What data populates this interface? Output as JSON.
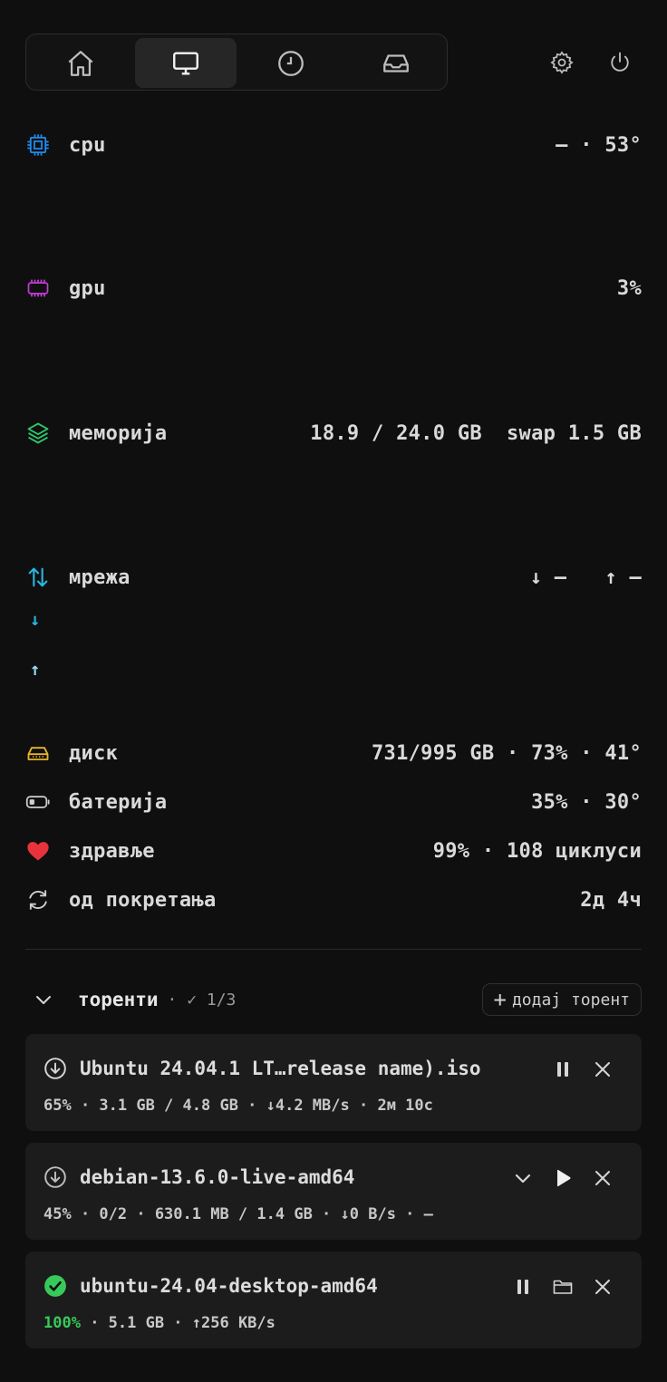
{
  "nav": {
    "tabs": [
      {
        "icon": "home-icon"
      },
      {
        "icon": "monitor-icon",
        "active": true
      },
      {
        "icon": "clock-icon"
      },
      {
        "icon": "inbox-icon"
      }
    ],
    "right_icons": [
      "gear-icon",
      "power-icon"
    ]
  },
  "stats": {
    "cpu": {
      "label": "cpu",
      "value": "— · 53°",
      "color": "#1e8cf0"
    },
    "gpu": {
      "label": "gpu",
      "value": "3%",
      "color": "#c23ad6"
    },
    "memory": {
      "label": "меморија",
      "value": "18.9 / 24.0 GB  swap 1.5 GB",
      "color": "#2fc36a"
    },
    "network": {
      "label": "мрежа",
      "down_value": "↓ —",
      "up_value": "↑ —",
      "down_arrow": "↓",
      "up_arrow": "↑",
      "color": "#28b7e0"
    },
    "disk": {
      "label": "диск",
      "value": "731/995 GB · 73% · 41°",
      "color": "#e6b52c"
    },
    "battery": {
      "label": "батерија",
      "value": "35% · 30°"
    },
    "health": {
      "label": "здравље",
      "value": "99% · 108 циклуси",
      "color": "#e8323c"
    },
    "uptime": {
      "label": "од покретања",
      "value": "2д 4ч"
    }
  },
  "torrents": {
    "title": "торенти",
    "count": "· ✓ 1/3",
    "add_label": "додај торент",
    "items": [
      {
        "name": "Ubuntu 24.04.1 LT…release name).iso",
        "meta": "65% · 3.1 GB / 4.8 GB · ↓4.2 MB/s · 2м 10с",
        "status": "downloading"
      },
      {
        "name": "debian-13.6.0-live-amd64",
        "meta": "45% · 0/2 · 630.1 MB / 1.4 GB · ↓0 B/s · —",
        "status": "paused"
      },
      {
        "name": "ubuntu-24.04-desktop-amd64",
        "meta_pct": "100%",
        "meta_rest": " · 5.1 GB · ↑256 KB/s",
        "status": "complete"
      }
    ]
  }
}
